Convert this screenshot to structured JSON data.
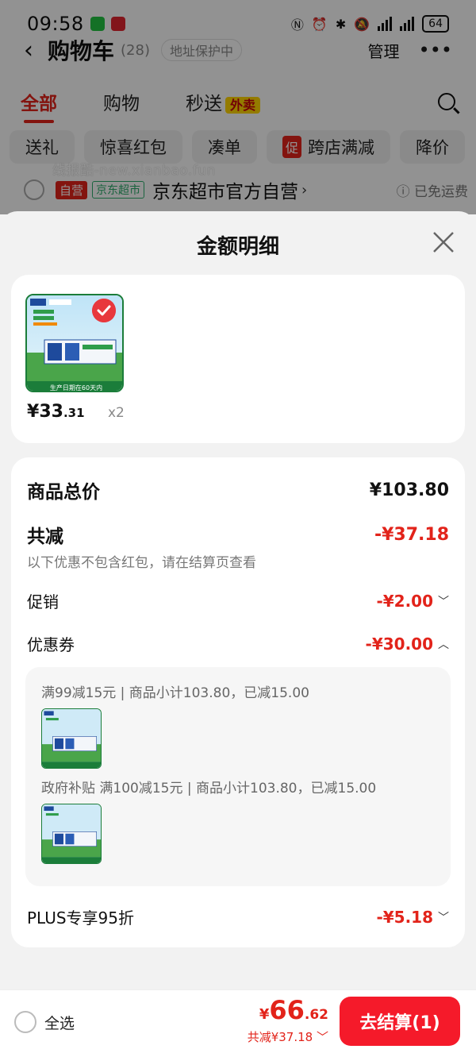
{
  "status_bar": {
    "time": "09:58",
    "battery": "64"
  },
  "cart_header": {
    "title": "购物车",
    "count": "(28)",
    "address_protect": "地址保护中",
    "manage": "管理"
  },
  "tabs": [
    {
      "label": "全部",
      "active": true
    },
    {
      "label": "购物",
      "active": false
    },
    {
      "label": "秒送",
      "active": false,
      "badge": "外卖"
    }
  ],
  "chips": [
    "送礼",
    "惊喜红包",
    "凑单",
    "跨店满减",
    "降价"
  ],
  "chip_promo_icon": "促",
  "store": {
    "self_tag": "自营",
    "jd_tag": "京东超市",
    "name": "京东超市官方自营",
    "shipping": "已免运费"
  },
  "watermark": "线报酷-new.xianbao.fun",
  "sheet": {
    "title": "金额明细"
  },
  "product": {
    "thumb_banner": "生产日期在60天内",
    "thumb_tag": "新鲜日期",
    "price_symbol": "¥",
    "price_int": "33",
    "price_dec": ".31",
    "qty": "x2"
  },
  "details": {
    "total_label": "商品总价",
    "total_value": "¥103.80",
    "reduce_label": "共减",
    "reduce_value": "-¥37.18",
    "reduce_note": "以下优惠不包含红包，请在结算页查看",
    "promo_label": "促销",
    "promo_value": "-¥2.00",
    "coupon_label": "优惠券",
    "coupon_value": "-¥30.00",
    "coupons": [
      {
        "text": "满99减15元 | 商品小计103.80，已减15.00"
      },
      {
        "text": "政府补贴 满100减15元 | 商品小计103.80，已减15.00"
      }
    ],
    "plus_label": "PLUS专享95折",
    "plus_value": "-¥5.18"
  },
  "bottom_bar": {
    "select_all": "全选",
    "total_symbol": "¥",
    "total_int": "66",
    "total_dec": ".62",
    "discount": "共减¥37.18",
    "checkout": "去结算(1)"
  },
  "colors": {
    "accent_red": "#e2231a",
    "checkout_red": "#f51a2a",
    "product_green": "#1b7d3a"
  },
  "icons": [
    "back-icon",
    "more-icon",
    "search-icon",
    "close-icon",
    "check-badge-icon",
    "chevron-down-icon",
    "chevron-up-icon"
  ]
}
